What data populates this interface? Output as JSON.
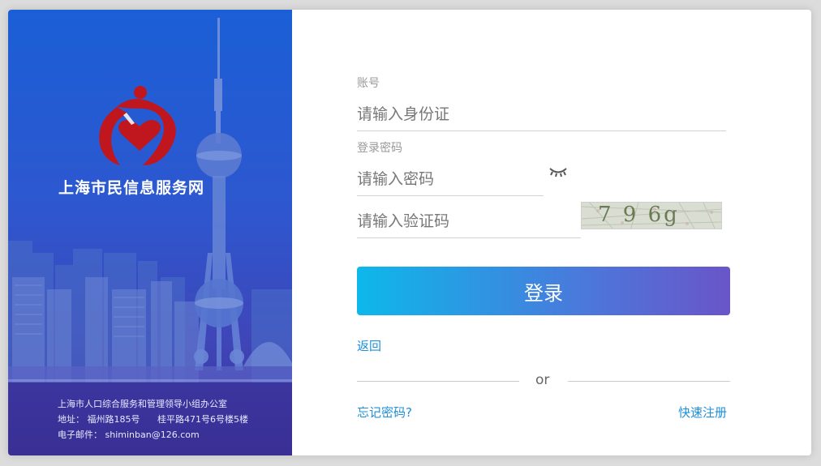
{
  "brand": {
    "name": "上海市民信息服务网",
    "colors": {
      "logo_red": "#c0161e",
      "accent_blue": "#1e8fd8",
      "panel_blue": "#2e57cf"
    }
  },
  "footer": {
    "office": "上海市人口综合服务和管理领导小组办公室",
    "address_label": "地址：",
    "address_1": "福州路185号",
    "address_2": "桂平路471号6号楼5楼",
    "email_label": "电子邮件：",
    "email": "shiminban@126.com"
  },
  "form": {
    "account_label": "账号",
    "account_placeholder": "请输入身份证",
    "password_label": "登录密码",
    "password_placeholder": "请输入密码",
    "password_toggle_icon": "eye-closed-icon",
    "captcha_placeholder": "请输入验证码",
    "captcha_text": "7 9 6g",
    "login_label": "登录",
    "back_label": "返回",
    "or_label": "or",
    "forgot_label": "忘记密码?",
    "register_label": "快速注册"
  }
}
